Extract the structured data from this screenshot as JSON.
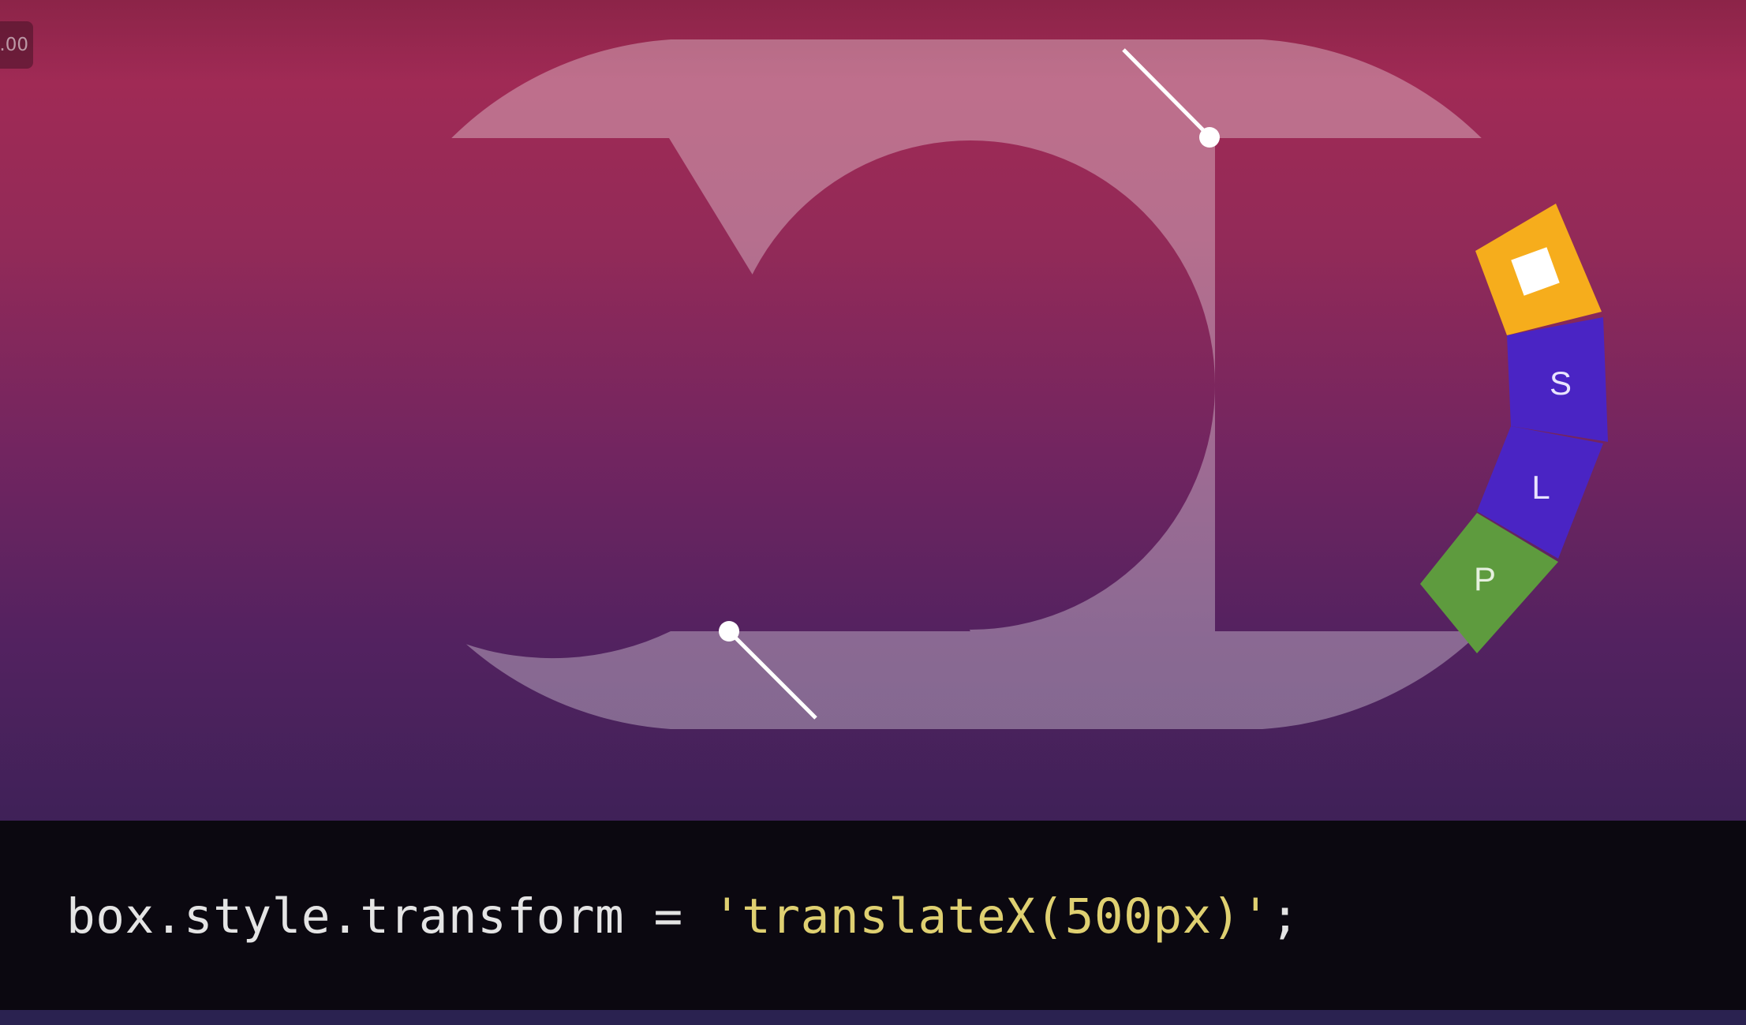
{
  "speed_badge": ".00",
  "track": {
    "color": "#ffffff",
    "opacity": 0.32
  },
  "segments": [
    {
      "label": "",
      "color": "#f6ad1c",
      "icon": "white-box"
    },
    {
      "label": "S",
      "color": "#4a24c4"
    },
    {
      "label": "L",
      "color": "#4a24c4"
    },
    {
      "label": "P",
      "color": "#5e9b3e"
    }
  ],
  "code": {
    "prefix": "box.style.transform = ",
    "string": "'translateX(500px)'",
    "suffix": ";",
    "string_color": "#dfd071",
    "text_color": "#e4e4e4"
  }
}
